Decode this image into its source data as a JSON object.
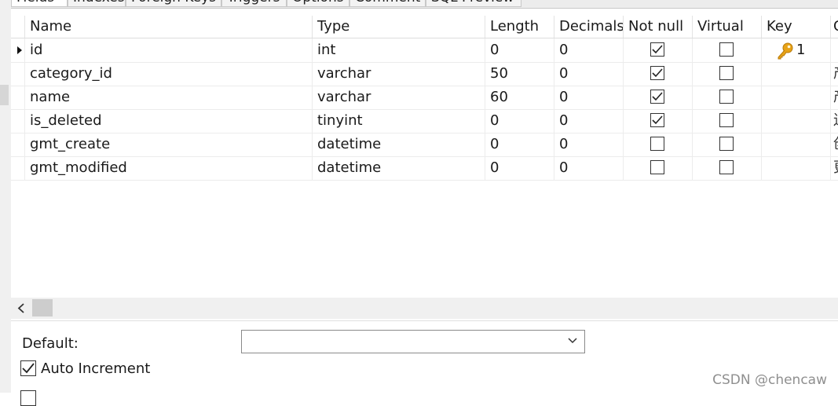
{
  "tabs": [
    {
      "label": "Fields",
      "active": true
    },
    {
      "label": "Indexes"
    },
    {
      "label": "Foreign Keys"
    },
    {
      "label": "Triggers"
    },
    {
      "label": "Options"
    },
    {
      "label": "Comment"
    },
    {
      "label": "SQL Preview"
    }
  ],
  "columns": {
    "name": "Name",
    "type": "Type",
    "length": "Length",
    "decimals": "Decimals",
    "not_null": "Not null",
    "virtual": "Virtual",
    "key": "Key",
    "comment_partial": "C"
  },
  "rows": [
    {
      "name": "id",
      "type": "int",
      "length": "0",
      "decimals": "0",
      "not_null": true,
      "virtual": false,
      "key": "1",
      "comment_partial": ""
    },
    {
      "name": "category_id",
      "type": "varchar",
      "length": "50",
      "decimals": "0",
      "not_null": true,
      "virtual": false,
      "key": "",
      "comment_partial": "产"
    },
    {
      "name": "name",
      "type": "varchar",
      "length": "60",
      "decimals": "0",
      "not_null": true,
      "virtual": false,
      "key": "",
      "comment_partial": "产"
    },
    {
      "name": "is_deleted",
      "type": "tinyint",
      "length": "0",
      "decimals": "0",
      "not_null": true,
      "virtual": false,
      "key": "",
      "comment_partial": "逻"
    },
    {
      "name": "gmt_create",
      "type": "datetime",
      "length": "0",
      "decimals": "0",
      "not_null": false,
      "virtual": false,
      "key": "",
      "comment_partial": "创"
    },
    {
      "name": "gmt_modified",
      "type": "datetime",
      "length": "0",
      "decimals": "0",
      "not_null": false,
      "virtual": false,
      "key": "",
      "comment_partial": "更"
    }
  ],
  "properties": {
    "default_label": "Default:",
    "default_value": "",
    "auto_increment_label": "Auto Increment",
    "auto_increment_checked": true
  },
  "watermark": "CSDN @chencaw",
  "icons": {
    "row_indicator": "row-pointer-icon",
    "primary_key": "key-icon",
    "dropdown": "chevron-down-icon",
    "scroll_left": "chevron-left-icon"
  },
  "colors": {
    "key_gold": "#e8a317",
    "grid_line": "#ececec",
    "scroll_track": "#f0f0f0"
  }
}
